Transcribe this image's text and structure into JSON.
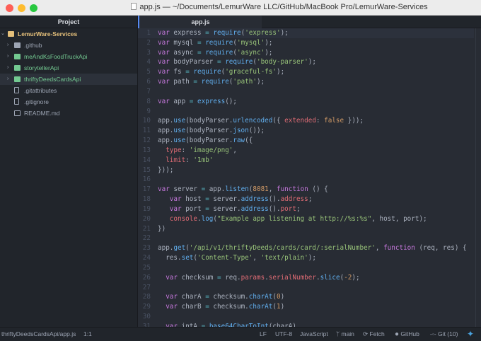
{
  "window": {
    "title": "app.js — ~/Documents/LemurWare LLC/GitHub/MacBook Pro/LemurWare-Services"
  },
  "sidebar": {
    "header": "Project",
    "items": [
      {
        "label": "LemurWare-Services",
        "type": "root"
      },
      {
        "label": ".github",
        "type": "folder"
      },
      {
        "label": "meAndKsFoodTruckApi",
        "type": "folder-green"
      },
      {
        "label": "storytellerApi",
        "type": "folder-green"
      },
      {
        "label": "thriftyDeedsCardsApi",
        "type": "folder-green",
        "selected": true
      },
      {
        "label": ".gitattributes",
        "type": "file"
      },
      {
        "label": ".gitignore",
        "type": "file"
      },
      {
        "label": "README.md",
        "type": "book"
      }
    ]
  },
  "tab": {
    "label": "app.js"
  },
  "code": [
    [
      [
        "k",
        "var"
      ],
      [
        "t",
        " express "
      ],
      [
        "o",
        "="
      ],
      [
        "t",
        " "
      ],
      [
        "f",
        "require"
      ],
      [
        "t",
        "("
      ],
      [
        "s",
        "'express'"
      ],
      [
        "t",
        ");"
      ]
    ],
    [
      [
        "k",
        "var"
      ],
      [
        "t",
        " mysql "
      ],
      [
        "o",
        "="
      ],
      [
        "t",
        " "
      ],
      [
        "f",
        "require"
      ],
      [
        "t",
        "("
      ],
      [
        "s",
        "'mysql'"
      ],
      [
        "t",
        ");"
      ]
    ],
    [
      [
        "k",
        "var"
      ],
      [
        "t",
        " async "
      ],
      [
        "o",
        "="
      ],
      [
        "t",
        " "
      ],
      [
        "f",
        "require"
      ],
      [
        "t",
        "("
      ],
      [
        "s",
        "'async'"
      ],
      [
        "t",
        ");"
      ]
    ],
    [
      [
        "k",
        "var"
      ],
      [
        "t",
        " bodyParser "
      ],
      [
        "o",
        "="
      ],
      [
        "t",
        " "
      ],
      [
        "f",
        "require"
      ],
      [
        "t",
        "("
      ],
      [
        "s",
        "'body-parser'"
      ],
      [
        "t",
        ");"
      ]
    ],
    [
      [
        "k",
        "var"
      ],
      [
        "t",
        " fs "
      ],
      [
        "o",
        "="
      ],
      [
        "t",
        " "
      ],
      [
        "f",
        "require"
      ],
      [
        "t",
        "("
      ],
      [
        "s",
        "'graceful-fs'"
      ],
      [
        "t",
        ");"
      ]
    ],
    [
      [
        "k",
        "var"
      ],
      [
        "t",
        " path "
      ],
      [
        "o",
        "="
      ],
      [
        "t",
        " "
      ],
      [
        "f",
        "require"
      ],
      [
        "t",
        "("
      ],
      [
        "s",
        "'path'"
      ],
      [
        "t",
        ");"
      ]
    ],
    [],
    [
      [
        "k",
        "var"
      ],
      [
        "t",
        " app "
      ],
      [
        "o",
        "="
      ],
      [
        "t",
        " "
      ],
      [
        "f",
        "express"
      ],
      [
        "t",
        "();"
      ]
    ],
    [],
    [
      [
        "t",
        "app."
      ],
      [
        "f",
        "use"
      ],
      [
        "t",
        "(bodyParser."
      ],
      [
        "f",
        "urlencoded"
      ],
      [
        "t",
        "({ "
      ],
      [
        "p",
        "extended"
      ],
      [
        "t",
        ": "
      ],
      [
        "n",
        "false"
      ],
      [
        "t",
        " }));"
      ]
    ],
    [
      [
        "t",
        "app."
      ],
      [
        "f",
        "use"
      ],
      [
        "t",
        "(bodyParser."
      ],
      [
        "f",
        "json"
      ],
      [
        "t",
        "());"
      ]
    ],
    [
      [
        "t",
        "app."
      ],
      [
        "f",
        "use"
      ],
      [
        "t",
        "(bodyParser."
      ],
      [
        "f",
        "raw"
      ],
      [
        "t",
        "({"
      ]
    ],
    [
      [
        "t",
        "  "
      ],
      [
        "p",
        "type"
      ],
      [
        "t",
        ": "
      ],
      [
        "s",
        "'image/png'"
      ],
      [
        "t",
        ","
      ]
    ],
    [
      [
        "t",
        "  "
      ],
      [
        "p",
        "limit"
      ],
      [
        "t",
        ": "
      ],
      [
        "s",
        "'1mb'"
      ]
    ],
    [
      [
        "t",
        "}));"
      ]
    ],
    [],
    [
      [
        "k",
        "var"
      ],
      [
        "t",
        " server "
      ],
      [
        "o",
        "="
      ],
      [
        "t",
        " app."
      ],
      [
        "f",
        "listen"
      ],
      [
        "t",
        "("
      ],
      [
        "n",
        "8081"
      ],
      [
        "t",
        ", "
      ],
      [
        "k",
        "function"
      ],
      [
        "t",
        " () {"
      ]
    ],
    [
      [
        "t",
        "   "
      ],
      [
        "k",
        "var"
      ],
      [
        "t",
        " host "
      ],
      [
        "o",
        "="
      ],
      [
        "t",
        " server."
      ],
      [
        "f",
        "address"
      ],
      [
        "t",
        "()."
      ],
      [
        "p",
        "address"
      ],
      [
        "t",
        ";"
      ]
    ],
    [
      [
        "t",
        "   "
      ],
      [
        "k",
        "var"
      ],
      [
        "t",
        " port "
      ],
      [
        "o",
        "="
      ],
      [
        "t",
        " server."
      ],
      [
        "f",
        "address"
      ],
      [
        "t",
        "()."
      ],
      [
        "p",
        "port"
      ],
      [
        "t",
        ";"
      ]
    ],
    [
      [
        "t",
        "   "
      ],
      [
        "p",
        "console"
      ],
      [
        "t",
        "."
      ],
      [
        "f",
        "log"
      ],
      [
        "t",
        "("
      ],
      [
        "s",
        "\"Example app listening at http://%s:%s\""
      ],
      [
        "t",
        ", host, port);"
      ]
    ],
    [
      [
        "t",
        "})"
      ]
    ],
    [],
    [
      [
        "t",
        "app."
      ],
      [
        "f",
        "get"
      ],
      [
        "t",
        "("
      ],
      [
        "s",
        "'/api/v1/thriftyDeeds/cards/card/:serialNumber'"
      ],
      [
        "t",
        ", "
      ],
      [
        "k",
        "function"
      ],
      [
        "t",
        " (req, res) {"
      ]
    ],
    [
      [
        "t",
        "  res."
      ],
      [
        "f",
        "set"
      ],
      [
        "t",
        "("
      ],
      [
        "s",
        "'Content-Type'"
      ],
      [
        "t",
        ", "
      ],
      [
        "s",
        "'text/plain'"
      ],
      [
        "t",
        ");"
      ]
    ],
    [],
    [
      [
        "t",
        "  "
      ],
      [
        "k",
        "var"
      ],
      [
        "t",
        " checksum "
      ],
      [
        "o",
        "="
      ],
      [
        "t",
        " req."
      ],
      [
        "p",
        "params"
      ],
      [
        "t",
        "."
      ],
      [
        "p",
        "serialNumber"
      ],
      [
        "t",
        "."
      ],
      [
        "f",
        "slice"
      ],
      [
        "t",
        "("
      ],
      [
        "n",
        "-2"
      ],
      [
        "t",
        ");"
      ]
    ],
    [],
    [
      [
        "t",
        "  "
      ],
      [
        "k",
        "var"
      ],
      [
        "t",
        " charA "
      ],
      [
        "o",
        "="
      ],
      [
        "t",
        " checksum."
      ],
      [
        "f",
        "charAt"
      ],
      [
        "t",
        "("
      ],
      [
        "n",
        "0"
      ],
      [
        "t",
        ")"
      ]
    ],
    [
      [
        "t",
        "  "
      ],
      [
        "k",
        "var"
      ],
      [
        "t",
        " charB "
      ],
      [
        "o",
        "="
      ],
      [
        "t",
        " checksum."
      ],
      [
        "f",
        "charAt"
      ],
      [
        "t",
        "("
      ],
      [
        "n",
        "1"
      ],
      [
        "t",
        ")"
      ]
    ],
    [],
    [
      [
        "t",
        "  "
      ],
      [
        "k",
        "var"
      ],
      [
        "t",
        " intA "
      ],
      [
        "o",
        "="
      ],
      [
        "t",
        " "
      ],
      [
        "f",
        "base64CharToInt"
      ],
      [
        "t",
        "(charA)"
      ]
    ]
  ],
  "status": {
    "path": "thriftyDeedsCardsApi/app.js",
    "cursor": "1:1",
    "eol": "LF",
    "encoding": "UTF-8",
    "grammar": "JavaScript",
    "branch": "main",
    "fetch": "Fetch",
    "github": "GitHub",
    "git": "Git (10)"
  }
}
